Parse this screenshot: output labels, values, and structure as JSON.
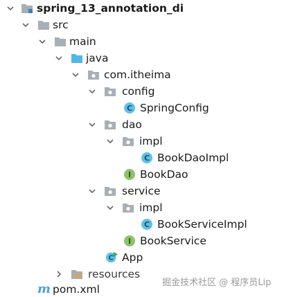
{
  "tree": {
    "root": "spring_13_annotation_di",
    "src": "src",
    "main": "main",
    "java": "java",
    "package": "com.itheima",
    "config": "config",
    "spring_config": "SpringConfig",
    "dao": "dao",
    "dao_impl": "impl",
    "book_dao_impl": "BookDaoImpl",
    "book_dao": "BookDao",
    "service": "service",
    "service_impl": "impl",
    "book_service_impl": "BookServiceImpl",
    "book_service": "BookService",
    "app": "App",
    "resources": "resources",
    "pom": "pom.xml"
  },
  "watermark": "掘金技术社区 @ 程序员Lip",
  "colors": {
    "folder": "#a9afb6",
    "java_folder": "#52b6e6",
    "class_circle": "#5ec1e8",
    "interface_circle": "#8ec26a",
    "maven": "#4c9fe0",
    "run_arrow": "#41a64a"
  }
}
